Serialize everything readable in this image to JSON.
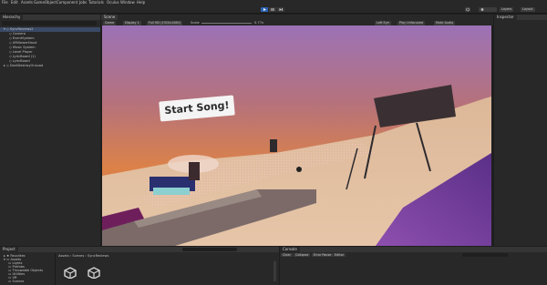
{
  "menu": [
    "File",
    "Edit",
    "Assets",
    "GameObject",
    "Component",
    "Jobs",
    "Tutorials",
    "Oculus",
    "Window",
    "Help"
  ],
  "toolbar": {
    "account": "Layers",
    "layout": "Layout"
  },
  "hierarchy": {
    "tab": "Hierarchy",
    "items": [
      {
        "label": "SyncReviews2",
        "indent": 0
      },
      {
        "label": "Camera",
        "indent": 2
      },
      {
        "label": "EventSystem",
        "indent": 2
      },
      {
        "label": "XRViewerHand",
        "indent": 2
      },
      {
        "label": "Music System",
        "indent": 2
      },
      {
        "label": "Level Player",
        "indent": 2
      },
      {
        "label": "LyricBoard (1)",
        "indent": 2
      },
      {
        "label": "LyricBoard",
        "indent": 2
      },
      {
        "label": "DontDestroyOnLoad",
        "indent": 0
      }
    ]
  },
  "scene": {
    "tabs": [
      "Scene",
      "Game"
    ],
    "toolbar": {
      "display": "Game",
      "display_num": "Display 1",
      "resolution": "Full HD (1920x1080)",
      "scale_label": "Scale",
      "scale_value": "0.77x",
      "eye": "Left Eye",
      "play": "Play Unfocused",
      "mute": "Mute Audio"
    },
    "sign": "Start Song!"
  },
  "inspector": {
    "tab": "Inspector"
  },
  "project": {
    "tab": "Project",
    "tree": [
      "Favorites",
      "Assets",
      "Lights",
      "Prefabs",
      "Throwable Objects",
      "Utilities",
      "VR",
      "Scenes"
    ],
    "breadcrumb": "Assets › Scenes › SyncReviews",
    "items": [
      "",
      ""
    ]
  },
  "console": {
    "tab": "Console",
    "buttons": [
      "Clear",
      "Collapse",
      "Error Pause",
      "Editor"
    ]
  },
  "colors": {
    "accent": "#2b63b4",
    "panel": "#282828",
    "dark": "#191919"
  }
}
